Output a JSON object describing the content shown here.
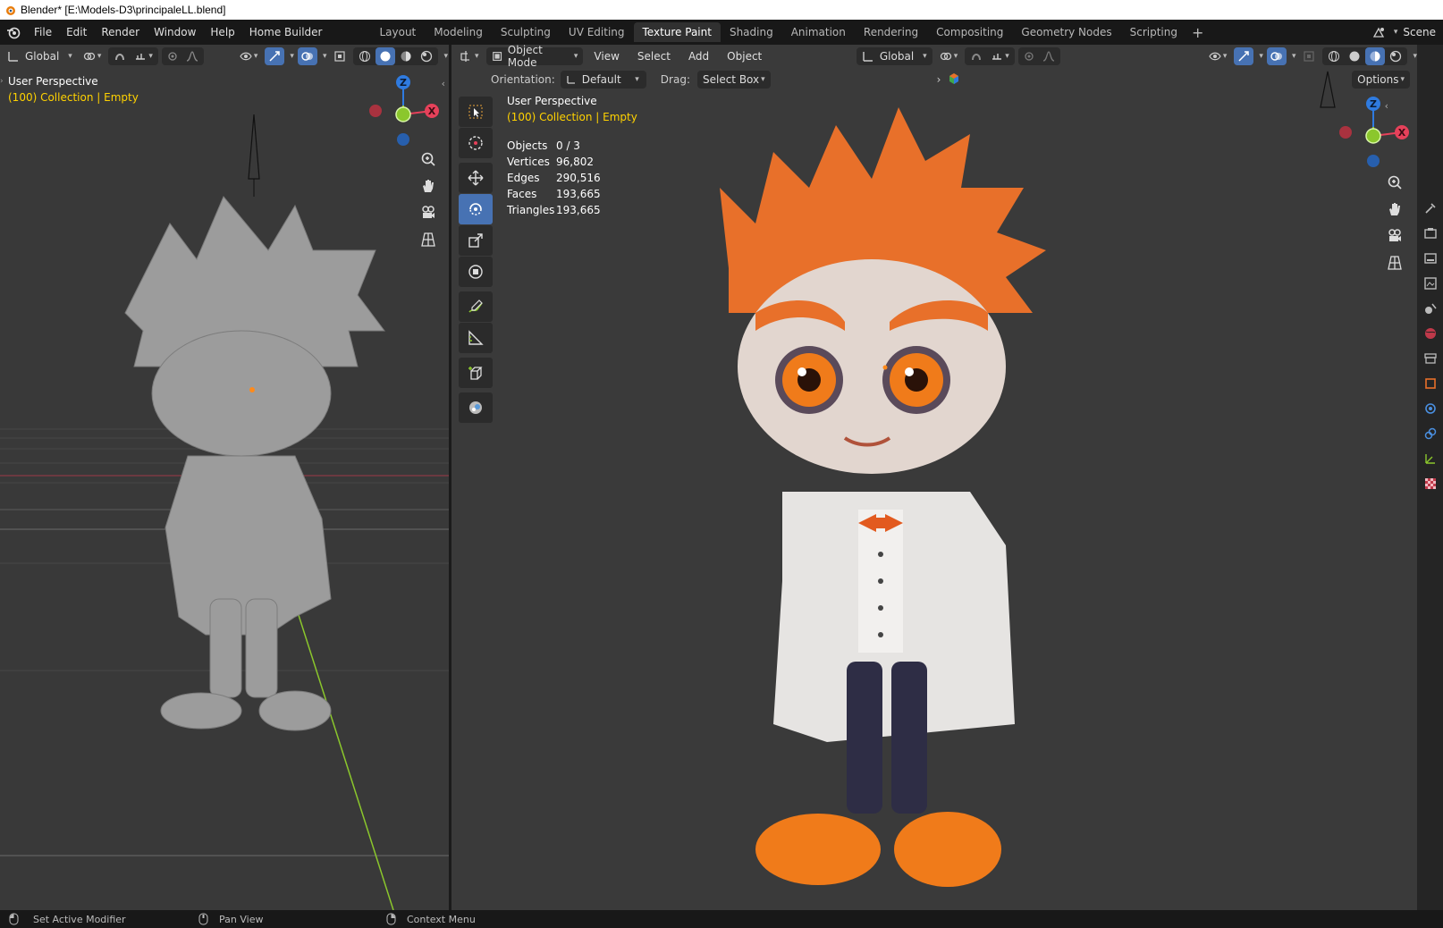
{
  "window": {
    "title": "Blender* [E:\\Models-D3\\principaleLL.blend]"
  },
  "menu": [
    "File",
    "Edit",
    "Render",
    "Window",
    "Help",
    "Home Builder"
  ],
  "workspaces": [
    "Layout",
    "Modeling",
    "Sculpting",
    "UV Editing",
    "Texture Paint",
    "Shading",
    "Animation",
    "Rendering",
    "Compositing",
    "Geometry Nodes",
    "Scripting"
  ],
  "active_workspace": "Texture Paint",
  "scene": {
    "name": "Scene"
  },
  "left_viewport": {
    "transform_orientation": "Global",
    "view_name": "User Perspective",
    "collection_info": "(100) Collection | Empty"
  },
  "right_viewport": {
    "mode": "Object Mode",
    "menus": [
      "View",
      "Select",
      "Add",
      "Object"
    ],
    "transform_orientation": "Global",
    "orientation_label": "Orientation:",
    "orientation_value": "Default",
    "drag_label": "Drag:",
    "drag_value": "Select Box",
    "options_label": "Options",
    "view_name": "User Perspective",
    "collection_info": "(100) Collection | Empty",
    "stats": [
      {
        "label": "Objects",
        "value": "0 / 3"
      },
      {
        "label": "Vertices",
        "value": "96,802"
      },
      {
        "label": "Edges",
        "value": "290,516"
      },
      {
        "label": "Faces",
        "value": "193,665"
      },
      {
        "label": "Triangles",
        "value": "193,665"
      }
    ]
  },
  "gizmo": {
    "z": "Z",
    "x": "X"
  },
  "status_bar": [
    "Set Active Modifier",
    "Pan View",
    "Context Menu"
  ],
  "colors": {
    "active_blue": "#4772b3",
    "x_axis": "#e6415a",
    "y_axis": "#8bc72c",
    "z_axis": "#2f7be0",
    "overlay_yellow": "#ffd200"
  }
}
